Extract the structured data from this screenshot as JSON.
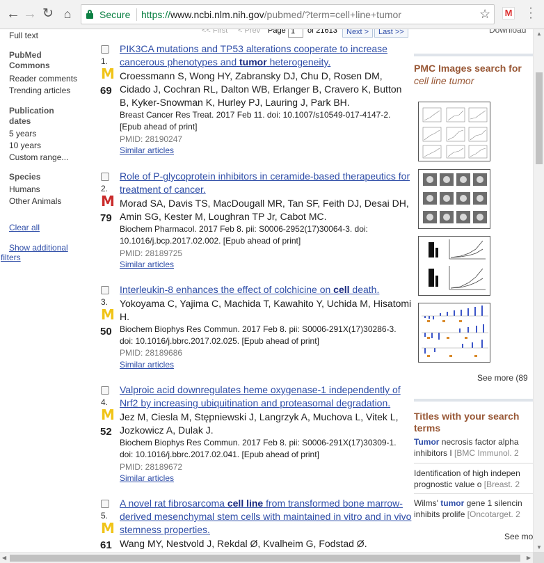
{
  "browser": {
    "security_label": "Secure",
    "url_scheme": "https://",
    "url_host": "www.ncbi.nlm.nih.gov",
    "url_rest": "/pubmed/?term=cell+line+tumor",
    "ext_label": "M"
  },
  "filters": {
    "full_text": "Full text",
    "pmc_head": "PubMed Commons",
    "reader_comments": "Reader comments",
    "trending": "Trending articles",
    "pub_head": "Publication dates",
    "five_years": "5 years",
    "ten_years": "10 years",
    "custom_range": "Custom range...",
    "species_head": "Species",
    "humans": "Humans",
    "other_animals": "Other Animals",
    "clear_all": "Clear all",
    "show_additional": "Show additional",
    "filters_word": "filters"
  },
  "pager": {
    "first": "<< First",
    "prev": "< Prev",
    "page_label": "Page",
    "page_value": "1",
    "of_total": "of 21613",
    "next": "Next >",
    "last": "Last >>"
  },
  "results": [
    {
      "num": "1.",
      "score": "69",
      "badge": "yellow",
      "title_pre": "PIK3CA mutations and TP53 alterations cooperate to increase cancerous phenotypes and ",
      "title_bold": "tumor",
      "title_post": " heterogeneity.",
      "authors": "Croessmann S, Wong HY, Zabransky DJ, Chu D, Rosen DM, Cidado J, Cochran RL, Dalton WB, Erlanger B, Cravero K, Button B, Kyker-Snowman K, Hurley PJ, Lauring J, Park BH.",
      "citation": "Breast Cancer Res Treat. 2017 Feb 11. doi: 10.1007/s10549-017-4147-2. [Epub ahead of print]",
      "pmid": "PMID: 28190247",
      "similar": "Similar articles"
    },
    {
      "num": "2.",
      "score": "79",
      "badge": "red",
      "title_pre": "Role of P-glycoprotein inhibitors in ceramide-based therapeutics for treatment of cancer.",
      "title_bold": "",
      "title_post": "",
      "authors": "Morad SA, Davis TS, MacDougall MR, Tan SF, Feith DJ, Desai DH, Amin SG, Kester M, Loughran TP Jr, Cabot MC.",
      "citation": "Biochem Pharmacol. 2017 Feb 8. pii: S0006-2952(17)30064-3. doi: 10.1016/j.bcp.2017.02.002. [Epub ahead of print]",
      "pmid": "PMID: 28189725",
      "similar": "Similar articles"
    },
    {
      "num": "3.",
      "score": "50",
      "badge": "yellow",
      "title_pre": "Interleukin-8 enhances the effect of colchicine on ",
      "title_bold": "cell",
      "title_post": " death.",
      "authors": "Yokoyama C, Yajima C, Machida T, Kawahito Y, Uchida M, Hisatomi H.",
      "citation": "Biochem Biophys Res Commun. 2017 Feb 8. pii: S0006-291X(17)30286-3. doi: 10.1016/j.bbrc.2017.02.025. [Epub ahead of print]",
      "pmid": "PMID: 28189686",
      "similar": "Similar articles"
    },
    {
      "num": "4.",
      "score": "52",
      "badge": "yellow",
      "title_pre": "Valproic acid downregulates heme oxygenase-1 independently of Nrf2 by increasing ubiquitination and proteasomal degradation.",
      "title_bold": "",
      "title_post": "",
      "authors": "Jez M, Ciesla M, Stępniewski J, Langrzyk A, Muchova L, Vitek L, Jozkowicz A, Dulak J.",
      "citation": "Biochem Biophys Res Commun. 2017 Feb 8. pii: S0006-291X(17)30309-1. doi: 10.1016/j.bbrc.2017.02.041. [Epub ahead of print]",
      "pmid": "PMID: 28189672",
      "similar": "Similar articles"
    },
    {
      "num": "5.",
      "score": "61",
      "badge": "yellow",
      "title_pre": "A novel rat fibrosarcoma ",
      "title_bold": "cell line",
      "title_post": " from transformed bone marrow-derived mesenchymal stem cells with maintained in vitro and in vivo stemness properties.",
      "authors": "Wang MY, Nestvold J, Rekdal Ø, Kvalheim G, Fodstad Ø.",
      "citation": "",
      "pmid": "",
      "similar": ""
    }
  ],
  "sidebar": {
    "download": "Download",
    "pmc_images_head": "PMC Images search for",
    "pmc_images_term": "cell line tumor",
    "see_more_images": "See more (89",
    "titles_head": "Titles with your search terms",
    "titles": [
      {
        "bold": "Tumor",
        "l1_rest": " necrosis factor alpha",
        "l2": "inhibitors I",
        "l2_grey": " [BMC Immunol. 2"
      },
      {
        "bold": "",
        "l1_rest": "Identification of high indepen",
        "l2": "prognostic value o",
        "l2_grey": " [Breast. 2"
      },
      {
        "bold": "",
        "l1_pre": "Wilms' ",
        "bold2": "tumor",
        "l1_rest": " gene 1 silencin",
        "l2": "inhibits prolife",
        "l2_grey": " [Oncotarget. 2"
      }
    ],
    "see_more_titles": "See mo"
  }
}
